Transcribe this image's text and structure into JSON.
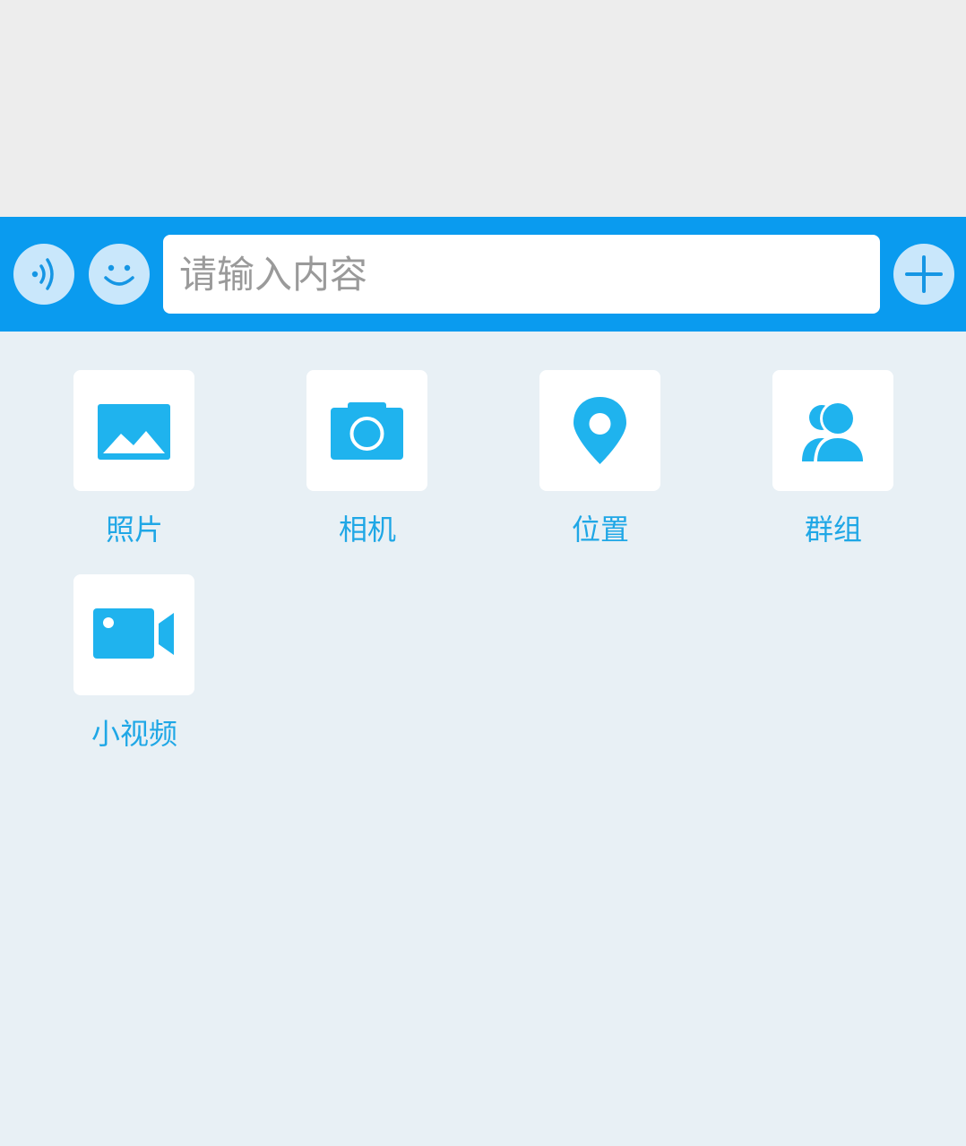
{
  "input_bar": {
    "placeholder": "请输入内容",
    "value": "",
    "voice_icon": "voice-wave-icon",
    "emoji_icon": "smiley-icon",
    "plus_icon": "plus-icon"
  },
  "tools": [
    {
      "label": "照片",
      "icon": "image-icon"
    },
    {
      "label": "相机",
      "icon": "camera-icon"
    },
    {
      "label": "位置",
      "icon": "location-pin-icon"
    },
    {
      "label": "群组",
      "icon": "group-icon"
    },
    {
      "label": "小视频",
      "icon": "video-camera-icon"
    }
  ],
  "colors": {
    "bar": "#0a9bef",
    "icon_accent": "#1fb3ee",
    "label": "#1fa7e6",
    "panel_bg": "#e8f0f5",
    "chat_bg": "#ededed",
    "round_button_bg": "#c9e7fb"
  }
}
